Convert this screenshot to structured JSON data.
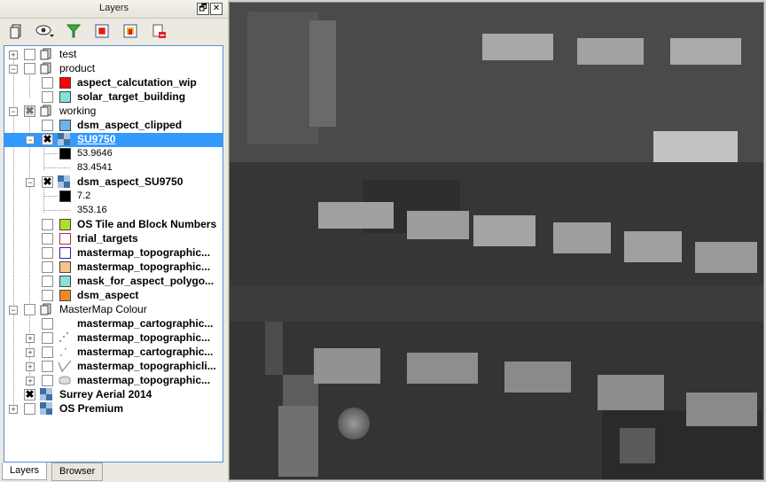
{
  "panel": {
    "title": "Layers",
    "float_btn": "🗗",
    "close_btn": "✕"
  },
  "tree": [
    {
      "label": "test",
      "bold": false
    },
    {
      "label": "product",
      "bold": false
    },
    {
      "label": "aspect_calcutation_wip",
      "bold": true,
      "swatch": "#ff0000"
    },
    {
      "label": "solar_target_building",
      "bold": true,
      "swatch": "#88e0d8"
    },
    {
      "label": "working",
      "bold": false
    },
    {
      "label": "dsm_aspect_clipped",
      "bold": true,
      "swatch": "#6fb3e8"
    },
    {
      "label": "SU9750",
      "bold": true,
      "selected": true
    },
    {
      "value": "53.9646"
    },
    {
      "value": "83.4541"
    },
    {
      "label": "dsm_aspect_SU9750",
      "bold": true
    },
    {
      "value": "7.2"
    },
    {
      "value": "353.16"
    },
    {
      "label": "OS Tile and Block Numbers",
      "bold": true,
      "swatch": "#aee027"
    },
    {
      "label": "trial_targets",
      "bold": true,
      "swatch": "#ffffff",
      "swatch_border": "#c0204a"
    },
    {
      "label": "mastermap_topographic...",
      "bold": true,
      "swatch": "#ffffff",
      "swatch_border": "#2222aa"
    },
    {
      "label": "mastermap_topographic...",
      "bold": true,
      "swatch": "#f7c48a"
    },
    {
      "label": "mask_for_aspect_polygo...",
      "bold": true,
      "swatch": "#88e0d8"
    },
    {
      "label": "dsm_aspect",
      "bold": true,
      "swatch": "#f08a20"
    },
    {
      "label": "MasterMap Colour",
      "bold": false
    },
    {
      "label": "mastermap_cartographic...",
      "bold": true
    },
    {
      "label": "mastermap_topographic...",
      "bold": true
    },
    {
      "label": "mastermap_cartographic...",
      "bold": true
    },
    {
      "label": "mastermap_topographicli...",
      "bold": true
    },
    {
      "label": "mastermap_topographic...",
      "bold": true
    },
    {
      "label": "Surrey Aerial 2014",
      "bold": true
    },
    {
      "label": "OS Premium",
      "bold": true
    }
  ],
  "tabs": {
    "layers": "Layers",
    "browser": "Browser"
  },
  "check_mark": "✖"
}
